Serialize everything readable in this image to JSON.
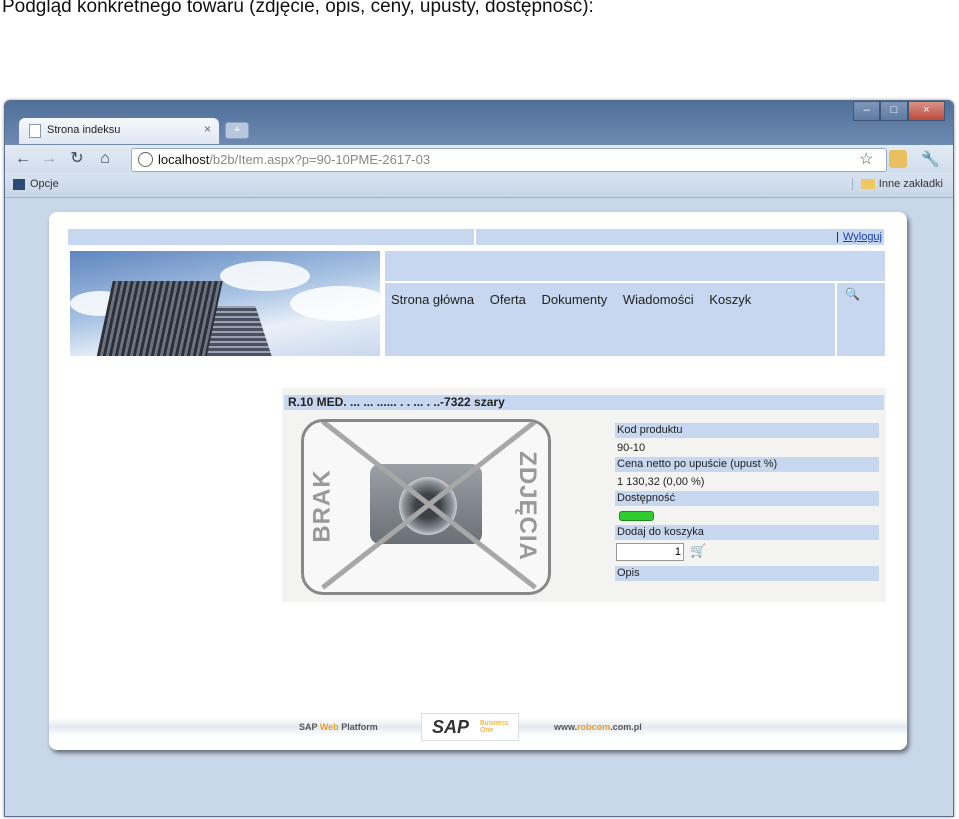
{
  "caption": "Podgląd konkretnego towaru (zdjęcie, opis, ceny, upusty, dostępność):",
  "browser": {
    "tab_title": "Strona indeksu",
    "tab_close": "×",
    "new_tab": "+",
    "url_host": "localhost",
    "url_path": "/b2b/Item.aspx?p=90-10PME-2617-03",
    "bookmark_opcje": "Opcje",
    "bookmark_inne": "Inne zakładki",
    "win_min": "–",
    "win_max": "□",
    "win_close": "×"
  },
  "site": {
    "logout_sep": "|",
    "logout": "Wyloguj",
    "menu": [
      "Strona główna",
      "Oferta",
      "Dokumenty",
      "Wiadomości",
      "Koszyk"
    ]
  },
  "product": {
    "title": "R.10 MED. ... ... ...... . . ... . ..-7322 szary",
    "photo_left": "BRAK",
    "photo_right": "ZDJĘCIA",
    "label_code": "Kod produktu",
    "code": "90-10",
    "label_price": "Cena netto po upuście (upust %)",
    "price": "1 130,32  (0,00 %)",
    "label_avail": "Dostępność",
    "availability_level": 1.0,
    "label_add": "Dodaj do koszyka",
    "qty": "1",
    "label_desc": "Opis"
  },
  "footer": {
    "sap_web_a": "SAP ",
    "sap_web_b": "Web",
    "sap_web_c": " Platform",
    "sap_logo": "SAP",
    "sap_sub": "Business One",
    "www_a": "www.",
    "www_b": "robcom",
    "www_c": ".com.pl"
  }
}
